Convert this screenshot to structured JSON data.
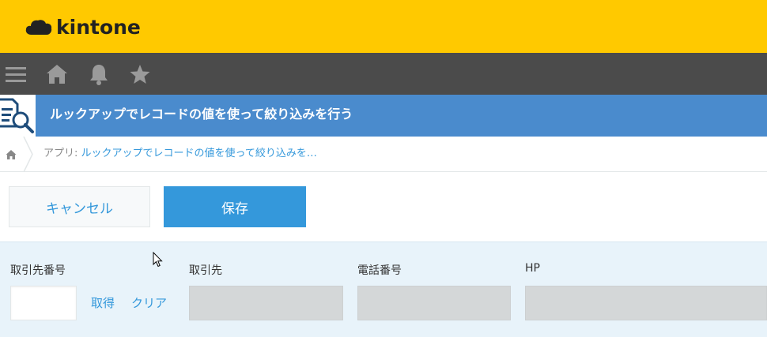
{
  "header": {
    "logo_text": "kintone",
    "brand_color": "#ffc900"
  },
  "nav": {
    "icons": [
      "menu-icon",
      "home-icon",
      "bell-icon",
      "star-icon"
    ]
  },
  "app": {
    "title": "ルックアップでレコードの値を使って絞り込みを行う",
    "icon": "app-document-search-icon"
  },
  "breadcrumb": {
    "prefix": "アプリ: ",
    "app_name": "ルックアップでレコードの値を使って絞り込みを…"
  },
  "actions": {
    "cancel_label": "キャンセル",
    "save_label": "保存"
  },
  "form": {
    "fields": [
      {
        "label": "取引先番号",
        "value": ""
      },
      {
        "label": "取引先",
        "value": ""
      },
      {
        "label": "電話番号",
        "value": ""
      },
      {
        "label": "HP",
        "value": ""
      }
    ],
    "lookup_get_label": "取得",
    "lookup_clear_label": "クリア"
  },
  "colors": {
    "nav_bg": "#4b4b4b",
    "app_bar": "#4a8bcd",
    "accent": "#3498db",
    "form_bg": "#e8f3fa"
  }
}
